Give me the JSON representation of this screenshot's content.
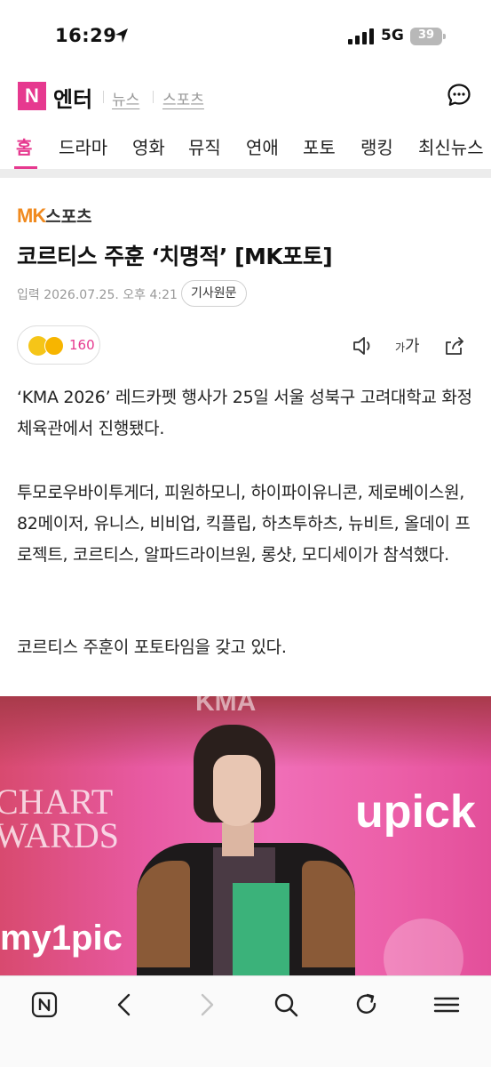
{
  "status_bar": {
    "time": "16:29",
    "network": "5G",
    "battery": "39"
  },
  "header": {
    "logo_letter": "N",
    "title": "엔터",
    "links": [
      "뉴스",
      "스포츠"
    ]
  },
  "nav": {
    "tabs": [
      "홈",
      "드라마",
      "영화",
      "뮤직",
      "연애",
      "포토",
      "랭킹",
      "최신뉴스"
    ],
    "active_index": 0
  },
  "article": {
    "source_prefix": "MK",
    "source_name": "스포츠",
    "headline": "코르티스 주훈 ‘치명적’ [MK포토]",
    "date": "입력 2026.07.25. 오후 4:21",
    "original_label": "기사원문",
    "reaction_count": "160",
    "font_label": "가",
    "paragraphs": [
      "‘KMA 2026’ 레드카펫 행사가 25일 서울 성북구 고려대학교 화정체육관에서 진행됐다.",
      "투모로우바이투게더, 피원하모니, 하이파이유니콘, 제로베이스원, 82메이저, 유니스, 비비업, 킥플립, 하츠투하츠, 뉴비트, 올데이 프로젝트, 코르티스, 알파드라이브원, 롱샷, 모디세이가 참석했다.",
      "코르티스 주훈이 포토타임을 갖고 있다."
    ]
  },
  "photo": {
    "text_top": "KMA",
    "text_left": "CHART\nWARDS",
    "text_right": "upick",
    "text_bottom": "my1pic"
  },
  "colors": {
    "brand": "#e6398f",
    "mk_orange": "#f08a1f"
  },
  "bottom_bar": {
    "icons": [
      "naver-home-icon",
      "back-icon",
      "forward-icon",
      "search-icon",
      "refresh-icon",
      "menu-icon"
    ]
  }
}
